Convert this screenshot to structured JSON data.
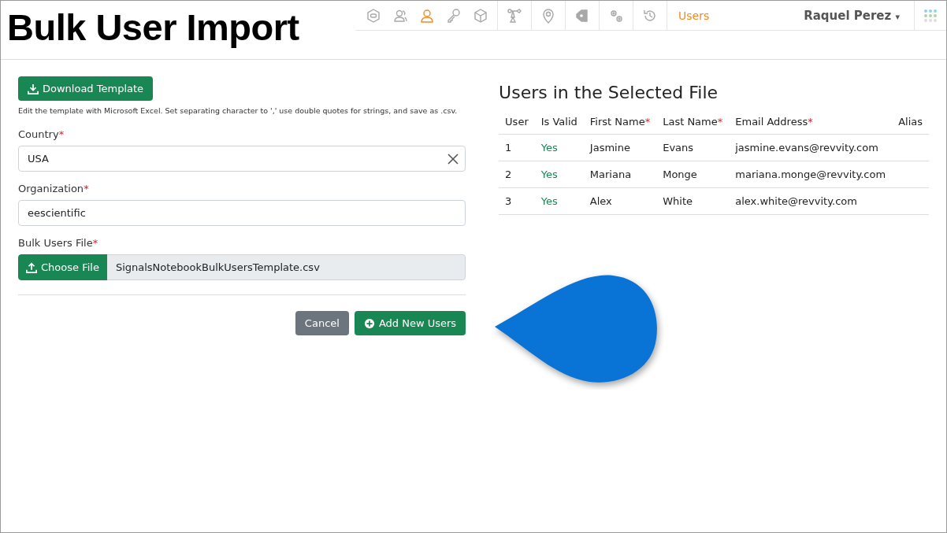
{
  "caption": "Bulk User Import",
  "nav": {
    "icons": [
      {
        "kind": "badge",
        "selected": false
      },
      {
        "kind": "users",
        "selected": false
      },
      {
        "kind": "user",
        "selected": true
      },
      {
        "kind": "key",
        "selected": false
      },
      {
        "kind": "cube",
        "selected": false
      },
      {
        "kind": "flow",
        "selected": false
      },
      {
        "kind": "pin",
        "selected": false
      },
      {
        "kind": "tag",
        "selected": false
      },
      {
        "kind": "gears",
        "selected": false
      },
      {
        "kind": "history",
        "selected": false
      }
    ],
    "section": "Users",
    "user": "Raquel Perez",
    "user_caret": "▾"
  },
  "form": {
    "download_button": "Download Template",
    "hint": "Edit the template with Microsoft Excel. Set separating character to ',' use double quotes for strings, and save as .csv.",
    "fields": [
      {
        "kind": "select",
        "label": "Country",
        "mark": "*",
        "value": "USA"
      },
      {
        "kind": "text",
        "label": "Organization",
        "mark": "*",
        "value": "eescientific"
      },
      {
        "kind": "file",
        "label": "Bulk Users File",
        "mark": "*",
        "button": "Choose File",
        "value": "SignalsNotebookBulkUsersTemplate.csv"
      }
    ],
    "cancel_button": "Cancel",
    "submit_button": "Add New Users"
  },
  "table": {
    "title": "Users in the Selected File",
    "columns": [
      {
        "label": "User"
      },
      {
        "label": "Is Valid"
      },
      {
        "label": "First Name",
        "mark": "*"
      },
      {
        "label": "Last Name",
        "mark": "*"
      },
      {
        "label": "Email Address",
        "mark": "*"
      },
      {
        "label": "Alias"
      }
    ],
    "rows": [
      [
        "1",
        "Yes",
        "Jasmine",
        "Evans",
        "jasmine.evans@revvity.com"
      ],
      [
        "2",
        "Yes",
        "Mariana",
        "Monge",
        "mariana.monge@revvity.com"
      ],
      [
        "3",
        "Yes",
        "Alex",
        "White",
        "alex.white@revvity.com"
      ]
    ]
  }
}
